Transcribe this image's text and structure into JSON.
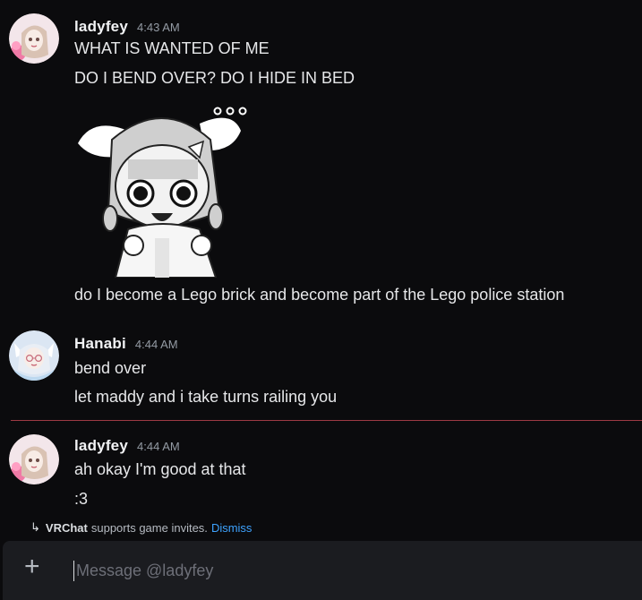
{
  "messages": [
    {
      "user": "ladyfey",
      "time": "4:43 AM",
      "lines": [
        "WHAT IS WANTED OF ME",
        "DO I BEND OVER? DO I HIDE IN BED"
      ],
      "after_sticker": "do I become a Lego brick and become part of the Lego police station"
    },
    {
      "user": "Hanabi",
      "time": "4:44 AM",
      "lines": [
        "bend over",
        "let maddy and i take turns railing you"
      ]
    },
    {
      "user": "ladyfey",
      "time": "4:44 AM",
      "lines": [
        "ah okay I'm good at that",
        ":3"
      ]
    }
  ],
  "notice": {
    "arrow": "↳",
    "app": "VRChat",
    "text": "supports game invites.",
    "dismiss": "Dismiss"
  },
  "composer": {
    "plus": "+",
    "placeholder": "Message @ladyfey"
  },
  "colors": {
    "background": "#0b0b0d",
    "divider": "#b8434f",
    "link": "#3ea3ff"
  }
}
